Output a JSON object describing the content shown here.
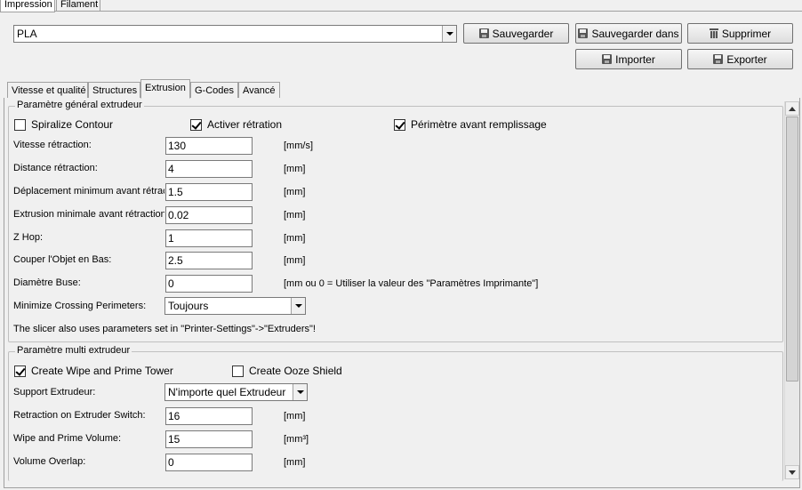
{
  "top_tabs": [
    {
      "label": "Impression",
      "active": true
    },
    {
      "label": "Filament",
      "active": false
    }
  ],
  "profile": {
    "selected": "PLA",
    "buttons": {
      "save": "Sauvegarder",
      "save_as": "Sauvegarder dans",
      "delete": "Supprimer",
      "import": "Importer",
      "export": "Exporter"
    }
  },
  "tabs": [
    {
      "label": "Vitesse et qualité"
    },
    {
      "label": "Structures"
    },
    {
      "label": "Extrusion"
    },
    {
      "label": "G-Codes"
    },
    {
      "label": "Avancé"
    }
  ],
  "active_tab": "Extrusion",
  "general": {
    "legend": "Paramètre général extrudeur",
    "checkboxes": [
      {
        "label": "Spiralize Contour",
        "checked": false
      },
      {
        "label": "Activer rétration",
        "checked": true
      },
      {
        "label": "Périmètre avant remplissage",
        "checked": true
      }
    ],
    "fields": [
      {
        "label": "Vitesse rétraction:",
        "value": "130",
        "unit": "[mm/s]"
      },
      {
        "label": "Distance rétraction:",
        "value": "4",
        "unit": "[mm]"
      },
      {
        "label": "Déplacement minimum avant rétraction:",
        "value": "1.5",
        "unit": "[mm]"
      },
      {
        "label": "Extrusion minimale avant rétraction:",
        "value": "0.02",
        "unit": "[mm]"
      },
      {
        "label": "Z Hop:",
        "value": "1",
        "unit": "[mm]"
      },
      {
        "label": "Couper l'Objet en Bas:",
        "value": "2.5",
        "unit": "[mm]"
      },
      {
        "label": "Diamètre Buse:",
        "value": "0",
        "unit": "[mm ou 0 = Utiliser la valeur des \"Paramètres Imprimante\"]"
      }
    ],
    "minimize": {
      "label": "Minimize Crossing Perimeters:",
      "value": "Toujours"
    },
    "note": "The slicer also uses parameters set in \"Printer-Settings\"->\"Extruders\"!"
  },
  "multi": {
    "legend": "Paramètre multi extrudeur",
    "checkboxes": [
      {
        "label": "Create Wipe and Prime Tower",
        "checked": true
      },
      {
        "label": "Create Ooze Shield",
        "checked": false
      }
    ],
    "support": {
      "label": "Support Extrudeur:",
      "value": "N'importe quel Extrudeur"
    },
    "fields": [
      {
        "label": "Retraction on Extruder Switch:",
        "value": "16",
        "unit": "[mm]"
      },
      {
        "label": "Wipe and Prime Volume:",
        "value": "15",
        "unit": "[mm³]"
      },
      {
        "label": "Volume Overlap:",
        "value": "0",
        "unit": "[mm]"
      }
    ]
  }
}
